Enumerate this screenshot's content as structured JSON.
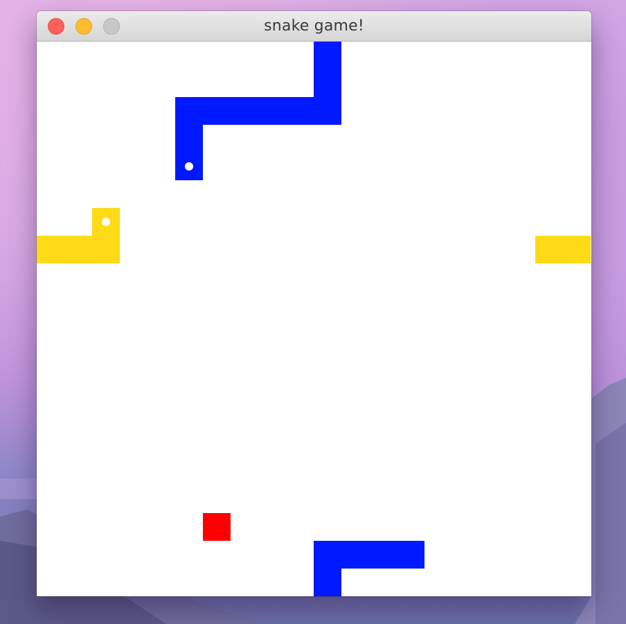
{
  "window": {
    "title": "snake game!",
    "buttons": {
      "close_color": "#fe5f57",
      "minimize_color": "#febc2e",
      "zoom_color": "#c8c8c8"
    }
  },
  "game": {
    "grid": {
      "columns": 20,
      "rows": 20
    },
    "colors": {
      "background": "#ffffff",
      "eye": "#ffffff"
    },
    "snakes": [
      {
        "color": "#0019ff",
        "head": [
          5,
          4
        ],
        "body": [
          [
            5,
            3
          ],
          [
            5,
            2
          ],
          [
            6,
            2
          ],
          [
            7,
            2
          ],
          [
            8,
            2
          ],
          [
            9,
            2
          ],
          [
            10,
            2
          ],
          [
            10,
            1
          ],
          [
            10,
            0
          ],
          [
            10,
            19
          ],
          [
            10,
            18
          ],
          [
            11,
            18
          ],
          [
            12,
            18
          ],
          [
            13,
            18
          ]
        ]
      },
      {
        "color": "#ffda17",
        "head": [
          2,
          6
        ],
        "body": [
          [
            2,
            7
          ],
          [
            1,
            7
          ],
          [
            0,
            7
          ],
          [
            19,
            7
          ],
          [
            18,
            7
          ]
        ]
      }
    ],
    "food": {
      "color": "#ff0000",
      "cell": [
        6,
        17
      ]
    }
  }
}
